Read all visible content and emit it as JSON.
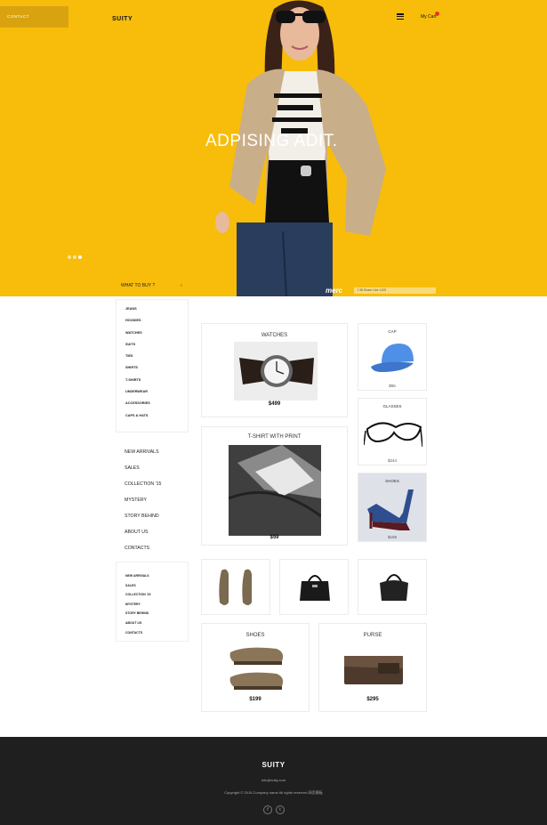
{
  "header": {
    "contact_label": "CONTACT",
    "brand": "SUITY",
    "menu_icon": "hamburger-icon",
    "cart_label": "My Cart",
    "cart_badge_color": "#e3342f"
  },
  "hero": {
    "headline": "ADPISING ADIT.",
    "slide_dots": 3,
    "what_to_buy": "WHAT TO BUY ?",
    "arrow": "›",
    "merc_logo": "merc",
    "share_text": "f 38 Share Like 1105",
    "background_color": "#f7bd0a"
  },
  "sidebar": {
    "categories": [
      "JEANS",
      "HOODIES",
      "WATCHES",
      "SUITS",
      "TIES",
      "SHIRTS",
      "T-SHIRTS",
      "UNDERWEAR",
      "ACCESSORIES",
      "CAPS & HATS"
    ],
    "nav": [
      "NEW ARRIVALS",
      "SALES",
      "COLLECTION '15",
      "MYSTERY",
      "STORY BEHIND",
      "ABOUT US",
      "CONTACTS"
    ],
    "small_nav": [
      "NEW ARRIVALS",
      "SALES",
      "COLLECTION '15",
      "MYSTERY",
      "STORY BEHIND",
      "ABOUT US",
      "CONTACTS"
    ]
  },
  "products": {
    "watches": {
      "title": "WATCHES",
      "price": "$499"
    },
    "cap": {
      "title": "CAP",
      "price": "$55"
    },
    "glasses": {
      "title": "GLASSES",
      "price": "$244"
    },
    "tshirt": {
      "title": "T-SHIRT WITH PRINT",
      "price": "$59"
    },
    "heels": {
      "title": "SHOES",
      "price": "$159"
    },
    "shoes": {
      "title": "SHOES",
      "price": "$199"
    },
    "purse": {
      "title": "PURSE",
      "price": "$295"
    }
  },
  "footer": {
    "brand": "SUITY",
    "email": "info@suity.com",
    "copyright": "Copyright © 2015 Company name All rights reserved.网页模板",
    "social": [
      "f",
      "t"
    ]
  }
}
